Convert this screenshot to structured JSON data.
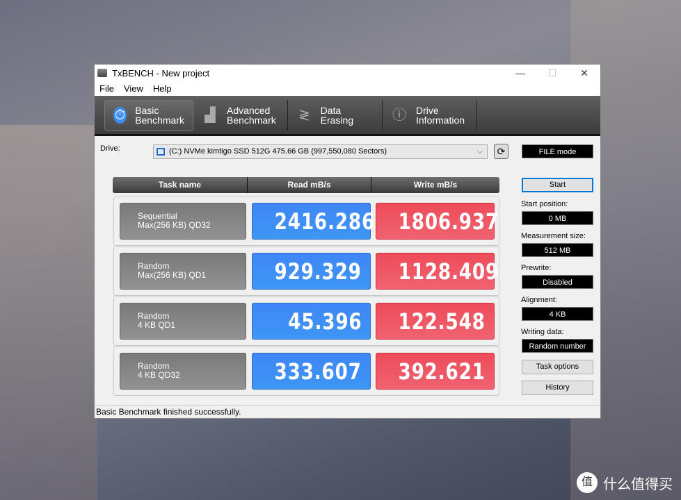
{
  "window": {
    "title": "TxBENCH - New project",
    "controls": [
      "—",
      "☐",
      "✕"
    ]
  },
  "menu": [
    "File",
    "View",
    "Help"
  ],
  "tabs": [
    {
      "line1": "Basic",
      "line2": "Benchmark",
      "icon": "stopwatch-icon",
      "active": true
    },
    {
      "line1": "Advanced",
      "line2": "Benchmark",
      "icon": "bar-chart-icon"
    },
    {
      "line1": "Data Erasing",
      "line2": "",
      "icon": "spring-icon"
    },
    {
      "line1": "Drive",
      "line2": "Information",
      "icon": "drive-info-icon"
    }
  ],
  "drive": {
    "label": "Drive:",
    "value": "(C:) NVMe kimtigo SSD 512G  475.66 GB (997,550,080 Sectors)",
    "chevron": "⌵",
    "refresh": "⟳"
  },
  "mode": "FILE mode",
  "table": {
    "headers": [
      "Task name",
      "Read mB/s",
      "Write mB/s"
    ],
    "rows": [
      {
        "line1": "Sequential",
        "line2": "Max(256 KB) QD32",
        "read": "2416.286",
        "write": "1806.937"
      },
      {
        "line1": "Random",
        "line2": "Max(256 KB) QD1",
        "read": "929.329",
        "write": "1128.409"
      },
      {
        "line1": "Random",
        "line2": "4 KB QD1",
        "read": "45.396",
        "write": "122.548"
      },
      {
        "line1": "Random",
        "line2": "4 KB QD32",
        "read": "333.607",
        "write": "392.621"
      }
    ]
  },
  "side": {
    "start": "Start",
    "start_position_label": "Start position:",
    "start_position": "0 MB",
    "measurement_label": "Measurement size:",
    "measurement": "512 MB",
    "prewrite_label": "Prewrite:",
    "prewrite": "Disabled",
    "alignment_label": "Alignment:",
    "alignment": "4 KB",
    "writing_label": "Writing data:",
    "writing": "Random number",
    "task_options": "Task options",
    "history": "History"
  },
  "status": "Basic Benchmark finished successfully.",
  "watermark": {
    "logo": "值",
    "text": "什么值得买"
  },
  "colors": {
    "read": "#3f8cf6",
    "write": "#ee5563",
    "accent": "#3c8ef0"
  }
}
